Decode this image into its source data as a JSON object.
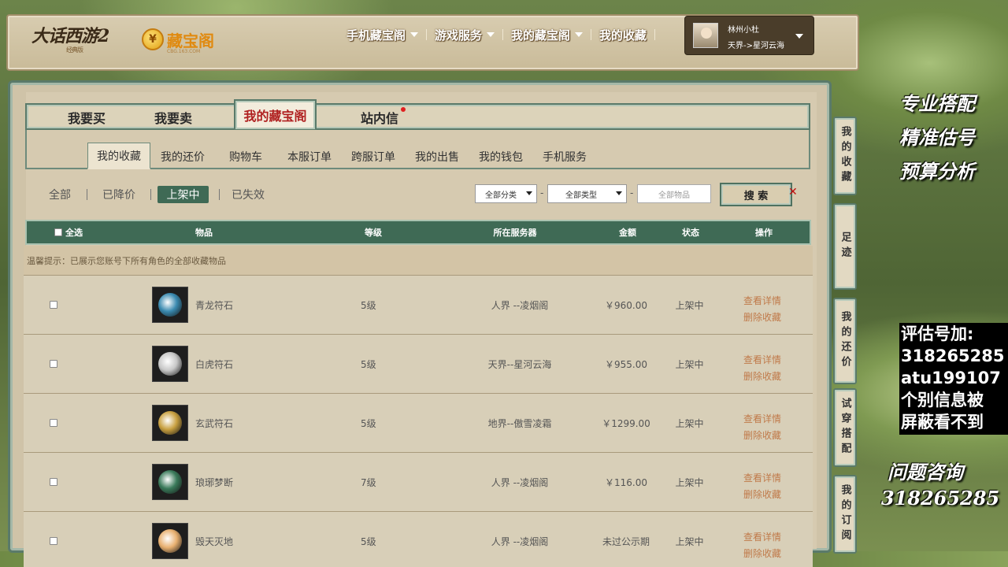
{
  "header": {
    "logo_text": "大话西游2",
    "logo_sub": "经典版",
    "cbg_logo": "藏宝阁",
    "cbg_url": "CBG.163.COM",
    "nav": [
      {
        "label": "手机藏宝阁",
        "dropdown": true
      },
      {
        "label": "游戏服务",
        "dropdown": true
      },
      {
        "label": "我的藏宝阁",
        "dropdown": true
      },
      {
        "label": "我的收藏",
        "dropdown": false
      }
    ],
    "user": {
      "name": "林州小杜",
      "server": "天界->星河云海"
    }
  },
  "main_tabs": [
    {
      "label": "我要买"
    },
    {
      "label": "我要卖"
    },
    {
      "label": "我的藏宝阁",
      "active": true
    },
    {
      "label": "站内信",
      "notify": true
    }
  ],
  "sub_tabs": [
    "我的收藏",
    "我的还价",
    "购物车",
    "本服订单",
    "跨服订单",
    "我的出售",
    "我的钱包",
    "手机服务"
  ],
  "filters": [
    "全部",
    "已降价",
    "上架中",
    "已失效"
  ],
  "search": {
    "category": "全部分类",
    "type": "全部类型",
    "item_placeholder": "全部物品",
    "button": "搜 索"
  },
  "table": {
    "headers": {
      "select_all": "全选",
      "item": "物品",
      "level": "等级",
      "server": "所在服务器",
      "price": "金额",
      "status": "状态",
      "action": "操作"
    },
    "tip": "温馨提示：已展示您账号下所有角色的全部收藏物品",
    "rows": [
      {
        "name": "青龙符石",
        "level": "5级",
        "server": "人界 --凌烟阁",
        "price": "￥960.00",
        "status": "上架中",
        "detail": "查看详情",
        "remove": "删除收藏",
        "gem_color": "#3a8ab0"
      },
      {
        "name": "白虎符石",
        "level": "5级",
        "server": "天界--星河云海",
        "price": "￥955.00",
        "status": "上架中",
        "detail": "查看详情",
        "remove": "删除收藏",
        "gem_color": "#c8c8c8"
      },
      {
        "name": "玄武符石",
        "level": "5级",
        "server": "地界--傲雪凌霜",
        "price": "￥1299.00",
        "status": "上架中",
        "detail": "查看详情",
        "remove": "删除收藏",
        "gem_color": "#c8a040"
      },
      {
        "name": "琅琊梦断",
        "level": "7级",
        "server": "人界 --凌烟阁",
        "price": "￥116.00",
        "status": "上架中",
        "detail": "查看详情",
        "remove": "删除收藏",
        "gem_color": "#3a7a5a"
      },
      {
        "name": "毁天灭地",
        "level": "5级",
        "server": "人界 --凌烟阁",
        "price": "未过公示期",
        "status": "上架中",
        "detail": "查看详情",
        "remove": "删除收藏",
        "gem_color": "#e8b070"
      }
    ]
  },
  "side_tabs": [
    "我的收藏",
    "足迹",
    "我的还价",
    "试穿搭配",
    "我的订阅"
  ],
  "promo": {
    "line1": "专业搭配",
    "line2": "精准估号",
    "line3": "预算分析",
    "contact": [
      "评估号加:",
      "318265285",
      "atu199107",
      "个别信息被",
      "屏蔽看不到"
    ],
    "consult": "问题咨询",
    "consult_num": "318265285"
  }
}
